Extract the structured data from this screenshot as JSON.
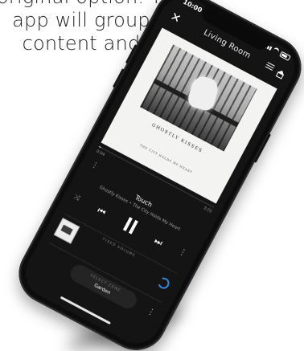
{
  "caption": {
    "lines": [
      "original option. The",
      "app will group",
      "content and"
    ]
  },
  "status_bar": {
    "time": "10:00"
  },
  "header": {
    "close_icon": "close-icon",
    "room": "Living Room",
    "queue_icon": "queue-icon",
    "home_icon": "home-icon"
  },
  "album": {
    "title": "GHOSTLY KISSES",
    "subtitle": "THE CITY HOLDS MY HEART"
  },
  "progress": {
    "elapsed": "0:04",
    "remaining": "3:25",
    "fraction": 0.02
  },
  "track": {
    "title": "Touch",
    "artist_line": "Ghostly Kisses • The City Holds My Heart"
  },
  "controls": {
    "shuffle_icon": "shuffle-icon",
    "prev_icon": "previous-icon",
    "pause_icon": "pause-icon",
    "next_icon": "next-icon",
    "more_icon": "more-icon"
  },
  "volume": {
    "label": "FIXED VOLUME",
    "sync_icon": "sync-icon"
  },
  "source": {
    "label": "SELECT ZONE",
    "name": "Garden",
    "more_icon": "more-icon"
  },
  "colors": {
    "accent": "#3a86d9",
    "screen_bg": "#141414",
    "art_bg": "#f3f3f1"
  }
}
